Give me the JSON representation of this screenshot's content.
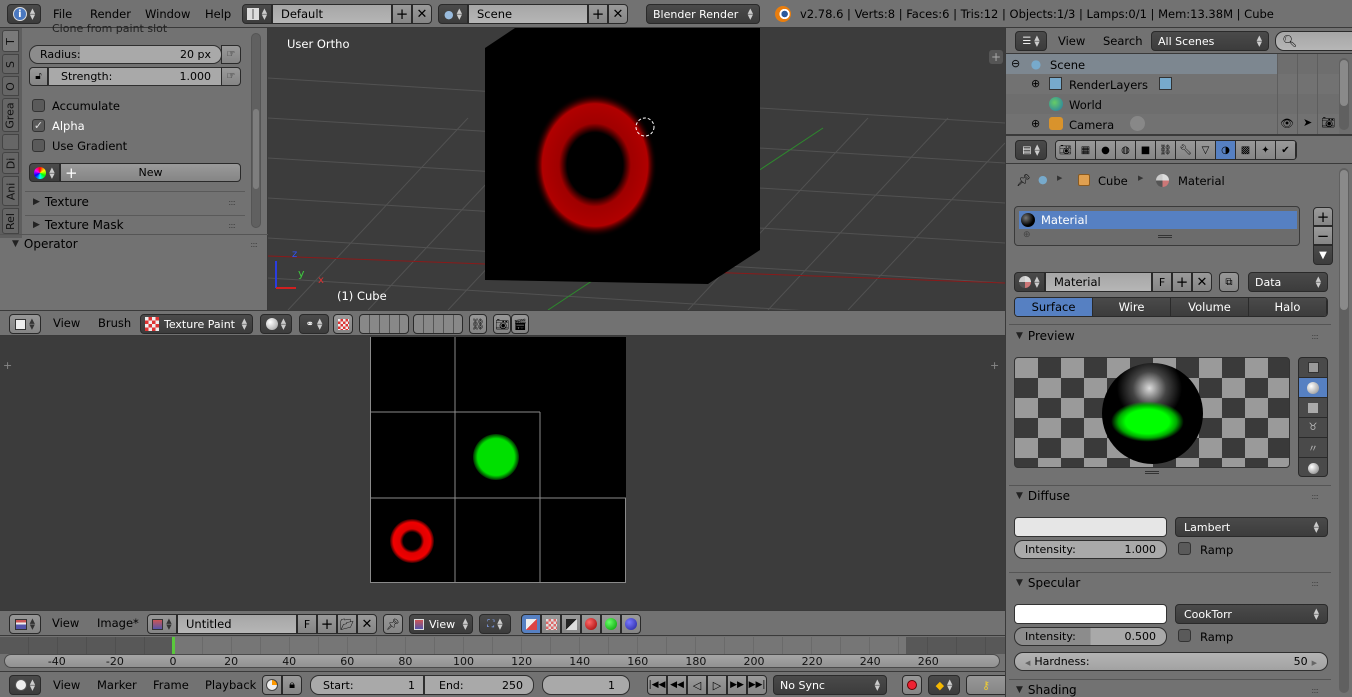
{
  "topbar": {
    "menus": [
      "File",
      "Render",
      "Window",
      "Help"
    ],
    "screen_layout": "Default",
    "scene": "Scene",
    "render_engine": "Blender Render",
    "stats": "v2.78.6 | Verts:8 | Faces:6 | Tris:12 | Objects:1/3 | Lamps:0/1 | Mem:13.38M | Cube"
  },
  "toolshelf": {
    "tabs": [
      "T",
      "S",
      "O",
      "Grea",
      "",
      "Di",
      "Ani",
      "Rel"
    ],
    "clipped_label": "Clone from paint slot",
    "radius_label": "Radius:",
    "radius_value": "20 px",
    "strength_label": "Strength:",
    "strength_value": "1.000",
    "checkboxes": [
      {
        "label": "Accumulate",
        "checked": false
      },
      {
        "label": "Alpha",
        "checked": true
      },
      {
        "label": "Use Gradient",
        "checked": false
      }
    ],
    "new_button": "New",
    "panels": [
      "Texture",
      "Texture Mask"
    ],
    "operator_panel": "Operator"
  },
  "viewport": {
    "view_label": "User Ortho",
    "object_label": "(1) Cube",
    "axis": {
      "x": "x",
      "y": "y",
      "z": "z"
    },
    "header": {
      "view": "View",
      "brush": "Brush",
      "mode": "Texture Paint"
    }
  },
  "image_editor": {
    "header": {
      "view": "View",
      "image": "Image*",
      "image_name": "Untitled",
      "fake_user": "F",
      "display_view": "View"
    }
  },
  "timeline": {
    "ticks": [
      "-40",
      "-20",
      "0",
      "20",
      "40",
      "60",
      "80",
      "100",
      "120",
      "140",
      "160",
      "180",
      "200",
      "220",
      "240",
      "260"
    ],
    "current_frame_marker": 0,
    "menus": [
      "View",
      "Marker",
      "Frame",
      "Playback"
    ],
    "start_label": "Start:",
    "start": "1",
    "end_label": "End:",
    "end": "250",
    "current": "1",
    "sync": "No Sync"
  },
  "outliner": {
    "menus": [
      "View",
      "Search"
    ],
    "filter": "All Scenes",
    "items": [
      {
        "label": "Scene",
        "level": 0,
        "expand": "minus"
      },
      {
        "label": "RenderLayers",
        "level": 1,
        "expand": "plus"
      },
      {
        "label": "World",
        "level": 1,
        "expand": ""
      },
      {
        "label": "Camera",
        "level": 1,
        "expand": "plus"
      }
    ]
  },
  "properties": {
    "breadcrumb": [
      "Cube",
      "Material"
    ],
    "material_slot": "Material",
    "material_name": "Material",
    "fake_user": "F",
    "link": "Data",
    "type_tabs": [
      "Surface",
      "Wire",
      "Volume",
      "Halo"
    ],
    "active_type": "Surface",
    "preview_title": "Preview",
    "diffuse": {
      "title": "Diffuse",
      "shader": "Lambert",
      "intensity_label": "Intensity:",
      "intensity": "1.000",
      "ramp": "Ramp",
      "color": "#e6e6e6"
    },
    "specular": {
      "title": "Specular",
      "shader": "CookTorr",
      "intensity_label": "Intensity:",
      "intensity": "0.500",
      "intensity_fraction": 0.5,
      "ramp": "Ramp",
      "hardness_label": "Hardness:",
      "hardness": "50",
      "color": "#ffffff"
    },
    "shading_title": "Shading"
  },
  "colors": {
    "accent": "#5680c2",
    "paint_red": "#e00000",
    "paint_green": "#00e000"
  }
}
